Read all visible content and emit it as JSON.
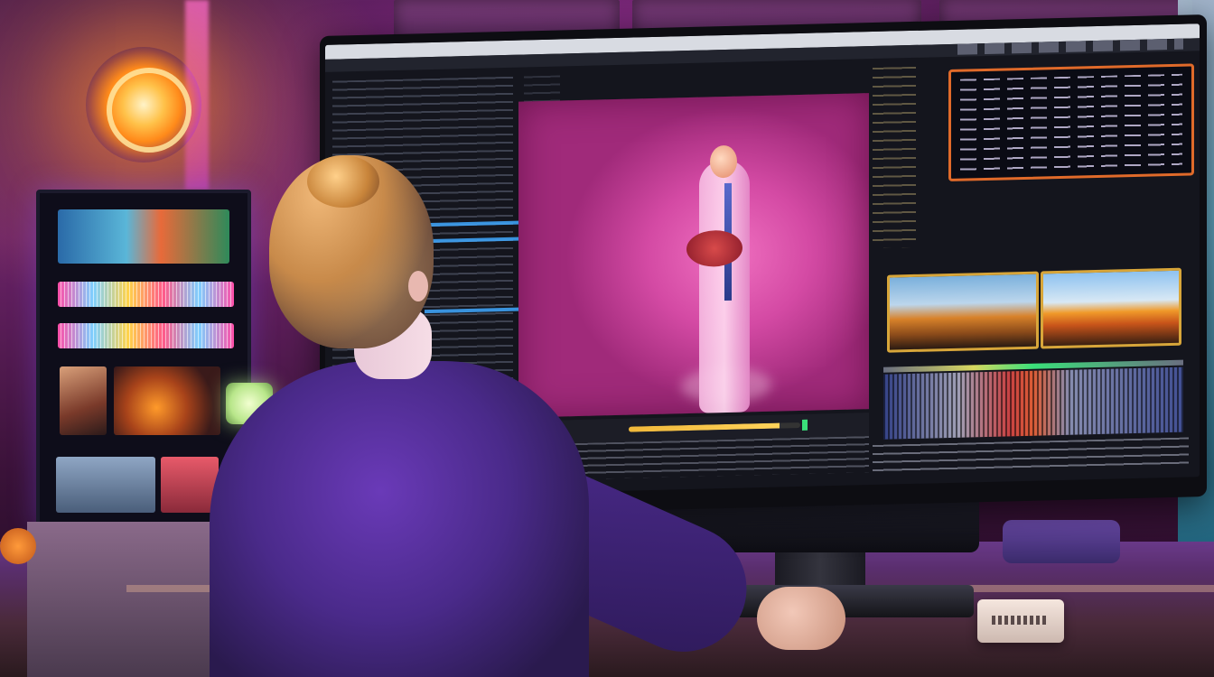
{
  "scene": {
    "description_name": "video-editing-workstation",
    "colors": {
      "wall_pink": "#6b2368",
      "lamp_orange": "#ff8a1a",
      "viewer_pink": "#d44aa4",
      "inspector_border": "#e06a2a",
      "thumb_border": "#d8a63a",
      "shirt_purple": "#4a2a8a",
      "timeline_blue": "#3fa8ff"
    }
  },
  "editor": {
    "viewer_progress_fraction": 0.88
  }
}
